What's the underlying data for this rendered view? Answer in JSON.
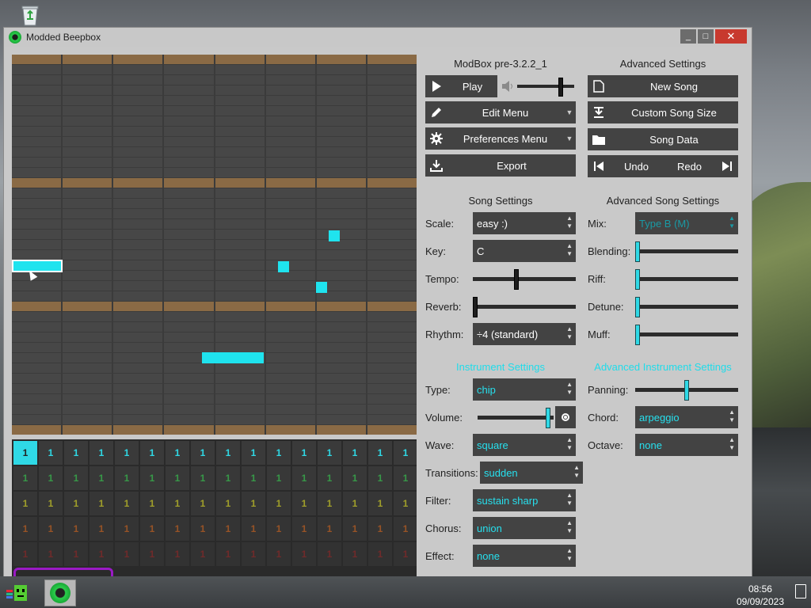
{
  "window": {
    "title": "Modded Beepbox",
    "minimize": "_",
    "maximize": "□",
    "close": "✕"
  },
  "pattern": {
    "notes_color": "#1fe3ee",
    "octave_color": "#8a6a45"
  },
  "tracks": {
    "rows": [
      {
        "color": "#2fd9e6",
        "values": [
          "1",
          "1",
          "1",
          "1",
          "1",
          "1",
          "1",
          "1",
          "1",
          "1",
          "1",
          "1",
          "1",
          "1",
          "1",
          "1"
        ]
      },
      {
        "color": "#39a94d",
        "values": [
          "1",
          "1",
          "1",
          "1",
          "1",
          "1",
          "1",
          "1",
          "1",
          "1",
          "1",
          "1",
          "1",
          "1",
          "1",
          "1"
        ]
      },
      {
        "color": "#c6c42b",
        "values": [
          "1",
          "1",
          "1",
          "1",
          "1",
          "1",
          "1",
          "1",
          "1",
          "1",
          "1",
          "1",
          "1",
          "1",
          "1",
          "1"
        ]
      },
      {
        "color": "#d76a25",
        "values": [
          "1",
          "1",
          "1",
          "1",
          "1",
          "1",
          "1",
          "1",
          "1",
          "1",
          "1",
          "1",
          "1",
          "1",
          "1",
          "1"
        ]
      },
      {
        "color": "#b02a2a",
        "values": [
          "1",
          "1",
          "1",
          "1",
          "1",
          "1",
          "1",
          "1",
          "1",
          "1",
          "1",
          "1",
          "1",
          "1",
          "1",
          "1"
        ]
      }
    ]
  },
  "left_col": {
    "heading": "ModBox pre-3.2.2_1",
    "play": "Play",
    "edit_menu": "Edit Menu",
    "preferences_menu": "Preferences Menu",
    "export": "Export"
  },
  "right_col": {
    "heading": "Advanced Settings",
    "new_song": "New Song",
    "custom_song_size": "Custom Song Size",
    "song_data": "Song Data",
    "undo": "Undo",
    "redo": "Redo"
  },
  "song_settings": {
    "heading": "Song Settings",
    "scale_label": "Scale:",
    "scale_value": "easy :)",
    "key_label": "Key:",
    "key_value": "C",
    "tempo_label": "Tempo:",
    "tempo_level": 0.42,
    "reverb_label": "Reverb:",
    "reverb_level": 0.0,
    "rhythm_label": "Rhythm:",
    "rhythm_value": "÷4 (standard)"
  },
  "advanced_song_settings": {
    "heading": "Advanced Song Settings",
    "mix_label": "Mix:",
    "mix_value": "Type B (M)",
    "blending_label": "Blending:",
    "blending_level": 0.0,
    "riff_label": "Riff:",
    "riff_level": 0.0,
    "detune_label": "Detune:",
    "detune_level": 0.0,
    "muff_label": "Muff:",
    "muff_level": 0.0
  },
  "instrument_settings": {
    "heading": "Instrument Settings",
    "type_label": "Type:",
    "type_value": "chip",
    "volume_label": "Volume:",
    "volume_level": 0.96,
    "wave_label": "Wave:",
    "wave_value": "square",
    "transitions_label": "Transitions:",
    "transitions_value": "sudden",
    "filter_label": "Filter:",
    "filter_value": "sustain sharp",
    "chorus_label": "Chorus:",
    "chorus_value": "union",
    "effect_label": "Effect:",
    "effect_value": "none"
  },
  "advanced_instrument_settings": {
    "heading": "Advanced Instrument Settings",
    "panning_label": "Panning:",
    "panning_level": 0.5,
    "chord_label": "Chord:",
    "chord_value": "arpeggio",
    "octave_label": "Octave:",
    "octave_value": "none"
  },
  "taskbar": {
    "time": "08:56",
    "date": "09/09/2023"
  }
}
